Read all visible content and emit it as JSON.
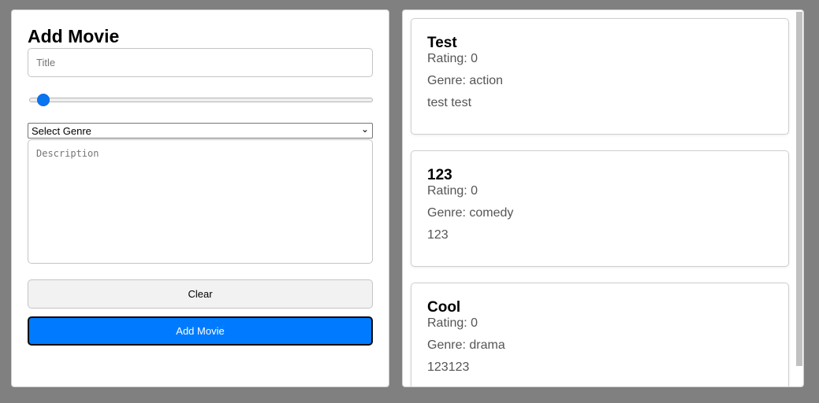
{
  "form": {
    "title": "Add Movie",
    "title_placeholder": "Title",
    "rating_value": 0,
    "genre_selected": "Select Genre",
    "description_placeholder": "Description",
    "clear_label": "Clear",
    "add_label": "Add Movie"
  },
  "movies": [
    {
      "title": "Test",
      "rating": "Rating: 0",
      "genre": "Genre: action",
      "description": "test test"
    },
    {
      "title": "123",
      "rating": "Rating: 0",
      "genre": "Genre: comedy",
      "description": "123"
    },
    {
      "title": "Cool",
      "rating": "Rating: 0",
      "genre": "Genre: drama",
      "description": "123123"
    }
  ],
  "colors": {
    "accent": "#007bff",
    "background": "#808080"
  }
}
